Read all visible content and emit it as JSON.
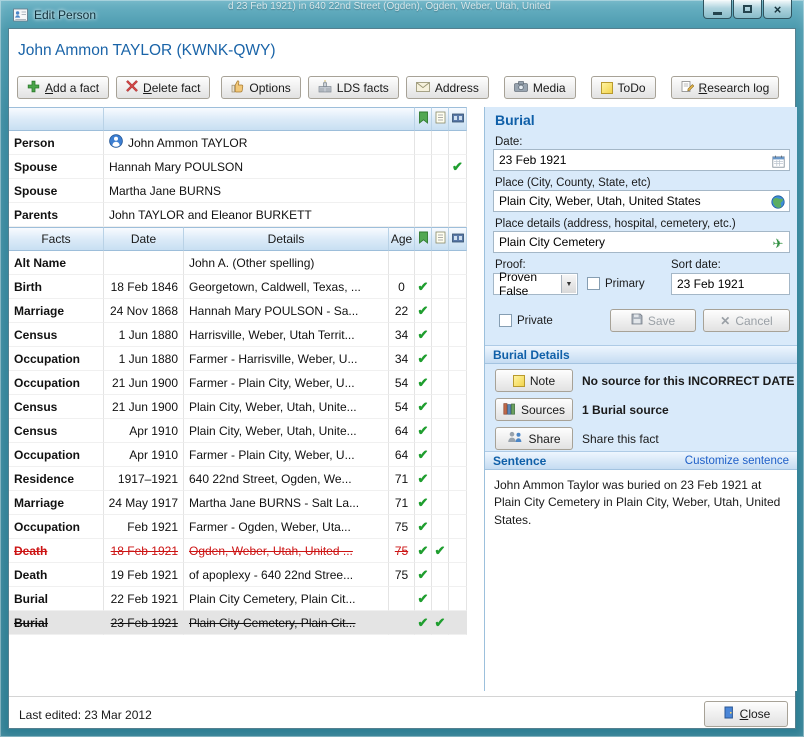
{
  "window": {
    "title": "Edit Person"
  },
  "background_text": "d 23 Feb 1921) in 640 22nd Street (Ogden), Ogden, Weber, Utah, United",
  "person_header": "John Ammon TAYLOR (KWNK-QWY)",
  "toolbar": {
    "add": "Add a fact",
    "delete": "Delete fact",
    "options": "Options",
    "lds": "LDS facts",
    "address": "Address",
    "media": "Media",
    "todo": "ToDo",
    "research": "Research log"
  },
  "people": {
    "rows": [
      {
        "label": "Person",
        "value": "John Ammon TAYLOR"
      },
      {
        "label": "Spouse",
        "value": "Hannah Mary POULSON"
      },
      {
        "label": "Spouse",
        "value": "Martha Jane BURNS"
      },
      {
        "label": "Parents",
        "value": "John TAYLOR and Eleanor BURKETT"
      }
    ]
  },
  "facts": {
    "headers": {
      "fact": "Facts",
      "date": "Date",
      "details": "Details",
      "age": "Age"
    },
    "rows": [
      {
        "fact": "Alt Name",
        "date": "",
        "details": "John A.  (Other spelling)",
        "age": ""
      },
      {
        "fact": "Birth",
        "date": "18 Feb 1846",
        "details": "Georgetown, Caldwell, Texas, ...",
        "age": "0"
      },
      {
        "fact": "Marriage",
        "date": "24 Nov 1868",
        "details": "Hannah Mary POULSON - Sa...",
        "age": "22"
      },
      {
        "fact": "Census",
        "date": "1 Jun 1880",
        "details": "Harrisville, Weber, Utah Territ...",
        "age": "34"
      },
      {
        "fact": "Occupation",
        "date": "1 Jun 1880",
        "details": "Farmer - Harrisville, Weber, U...",
        "age": "34"
      },
      {
        "fact": "Occupation",
        "date": "21 Jun 1900",
        "details": "Farmer - Plain City, Weber, U...",
        "age": "54"
      },
      {
        "fact": "Census",
        "date": "21 Jun 1900",
        "details": "Plain City, Weber, Utah, Unite...",
        "age": "54"
      },
      {
        "fact": "Census",
        "date": "Apr 1910",
        "details": "Plain City, Weber, Utah, Unite...",
        "age": "64"
      },
      {
        "fact": "Occupation",
        "date": "Apr 1910",
        "details": "Farmer - Plain City, Weber, U...",
        "age": "64"
      },
      {
        "fact": "Residence",
        "date": "1917–1921",
        "details": "640 22nd Street, Ogden, We...",
        "age": "71"
      },
      {
        "fact": "Marriage",
        "date": "24 May 1917",
        "details": "Martha Jane BURNS - Salt La...",
        "age": "71"
      },
      {
        "fact": "Occupation",
        "date": "Feb 1921",
        "details": "Farmer - Ogden, Weber, Uta...",
        "age": "75"
      },
      {
        "fact": "Death",
        "date": "18 Feb 1921",
        "details": "Ogden, Weber, Utah, United ...",
        "age": "75"
      },
      {
        "fact": "Death",
        "date": "19 Feb 1921",
        "details": "of apoplexy - 640 22nd Stree...",
        "age": "75"
      },
      {
        "fact": "Burial",
        "date": "22 Feb 1921",
        "details": "Plain City Cemetery, Plain Cit...",
        "age": ""
      },
      {
        "fact": "Burial",
        "date": "23 Feb 1921",
        "details": "Plain City Cemetery, Plain Cit...",
        "age": ""
      }
    ]
  },
  "panel": {
    "title": "Burial",
    "date_label": "Date:",
    "date_value": "23 Feb 1921",
    "place_label": "Place (City, County, State, etc)",
    "place_value": "Plain City, Weber, Utah, United States",
    "place_details_label": "Place details (address, hospital, cemetery, etc.)",
    "place_details_value": "Plain City Cemetery",
    "proof_label": "Proof:",
    "proof_value": "Proven False",
    "primary_label": "Primary",
    "sort_date_label": "Sort date:",
    "sort_date_value": "23 Feb 1921",
    "private_label": "Private",
    "save_label": "Save",
    "cancel_label": "Cancel",
    "details_header": "Burial Details",
    "note_button": "Note",
    "note_text": "No source for this INCORRECT DATE in",
    "sources_button": "Sources",
    "sources_text": "1 Burial source",
    "share_button": "Share",
    "share_text": "Share this fact",
    "sentence_header": "Sentence",
    "customize_link": "Customize sentence",
    "sentence_text": "John Ammon Taylor was buried on 23 Feb 1921 at Plain City Cemetery in Plain City, Weber, Utah, United States."
  },
  "footer": {
    "last_edited": "Last edited: 23 Mar 2012",
    "close": "Close"
  }
}
